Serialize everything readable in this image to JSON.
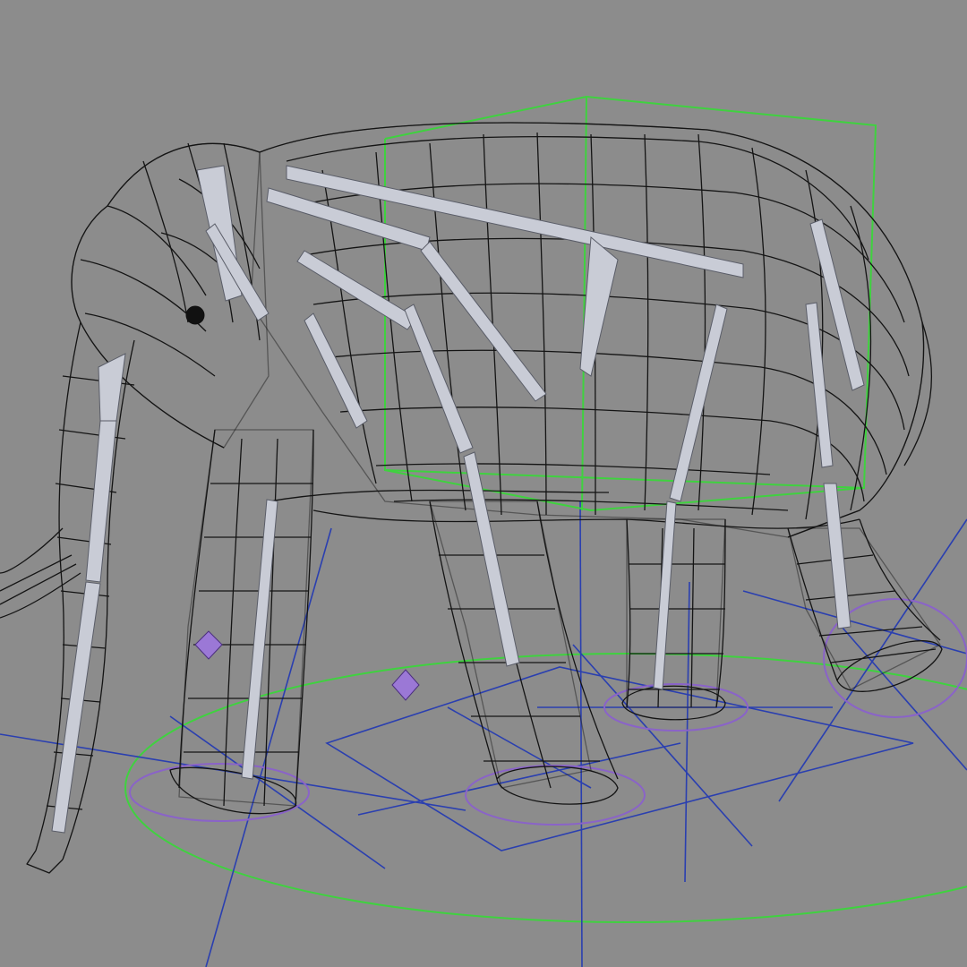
{
  "viewport": {
    "view": "perspective",
    "display_mode": "wireframe",
    "background": "#8c8c8c"
  },
  "colors": {
    "wireframe": "#141414",
    "bones": "#c9ccd6",
    "bounding_box": "#3fd23f",
    "ik_handles": "#8a63c8",
    "ground_grid": "#2a3fb0"
  },
  "scene": {
    "model": "elephant",
    "rig": {
      "bones_visible": true,
      "bounding_box_visible": true,
      "ik_circles": 4,
      "locator_gizmos": 2
    }
  }
}
